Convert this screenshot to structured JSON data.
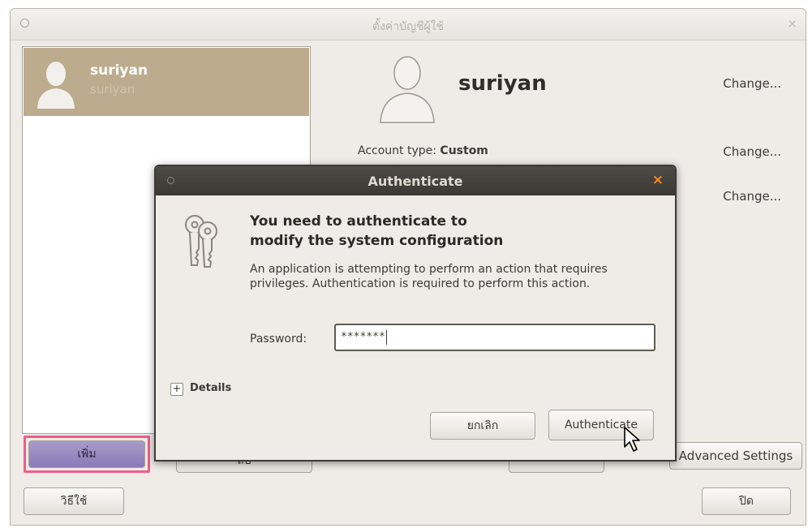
{
  "window": {
    "title": "ตั้งค่าบัญชีผู้ใช้",
    "close_glyph": "×"
  },
  "user_list": {
    "items": [
      {
        "name": "suriyan",
        "login": "suriyan"
      }
    ]
  },
  "details": {
    "name": "suriyan",
    "account_type_label": "Account type:",
    "account_type_value": "Custom",
    "change_labels": [
      "Change...",
      "Change...",
      "Change..."
    ]
  },
  "buttons": {
    "add": "เพิ่ม",
    "remove": "ลบ",
    "middle": "",
    "advanced": "Advanced Settings",
    "help": "วิธีใช้",
    "close": "ปิด"
  },
  "dialog": {
    "title": "Authenticate",
    "close_glyph": "×",
    "heading_line1": "You need to authenticate to",
    "heading_line2": "modify the system configuration",
    "body": "An application is attempting to perform an action that requires privileges. Authentication is required to perform this action.",
    "password_label": "Password:",
    "password_value": "*******",
    "details_toggle": "+",
    "details_label": "Details",
    "cancel": "ยกเลิก",
    "authenticate": "Authenticate"
  },
  "colors": {
    "selection": "#bcac8d",
    "dialog_title_bg": "#3c3b37",
    "close_accent": "#f58a2a",
    "highlight": "#ef5d8a"
  }
}
